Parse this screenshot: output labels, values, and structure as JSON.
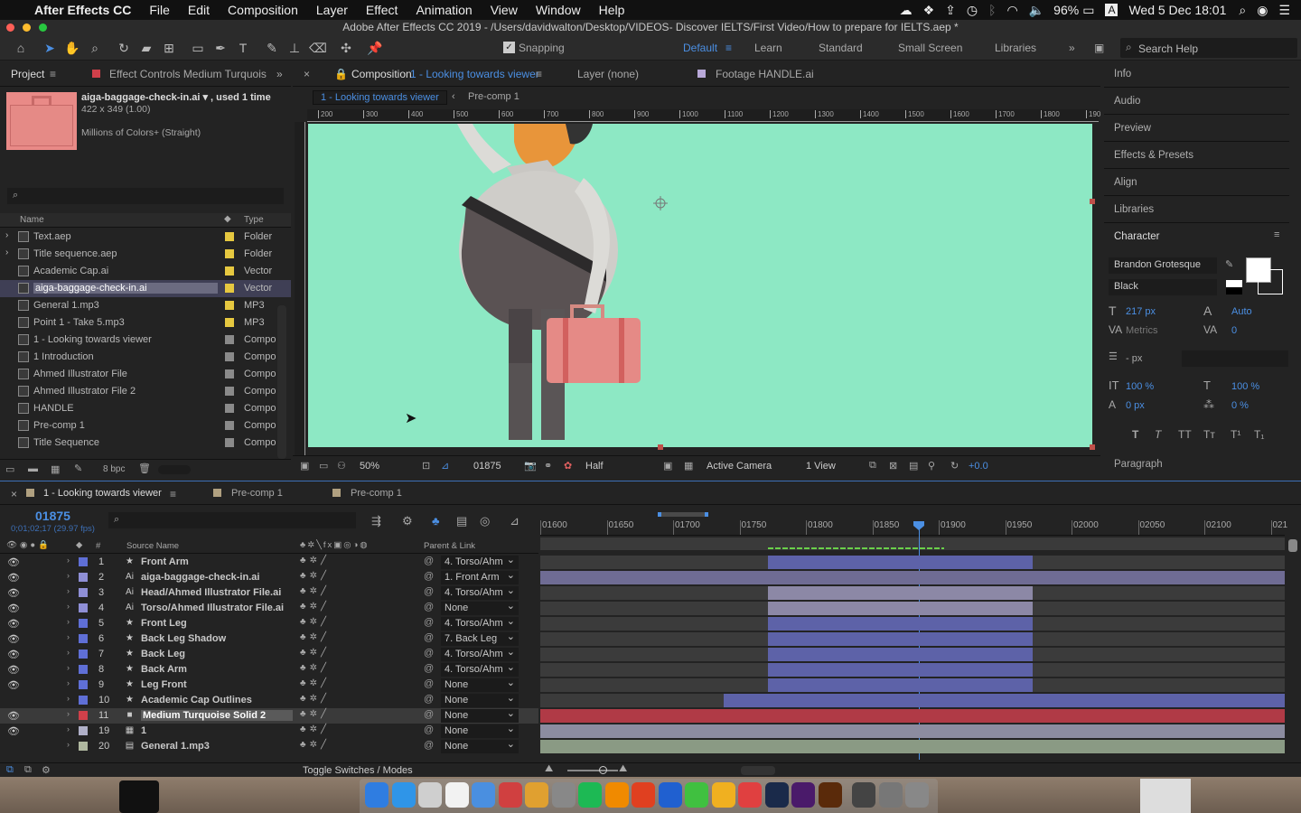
{
  "menubar": {
    "app": "After Effects CC",
    "items": [
      "File",
      "Edit",
      "Composition",
      "Layer",
      "Effect",
      "Animation",
      "View",
      "Window",
      "Help"
    ],
    "battery": "96%",
    "datetime": "Wed 5 Dec  18:01",
    "input": "A"
  },
  "titlebar": {
    "title": "Adobe After Effects CC 2019 - /Users/davidwalton/Desktop/VIDEOS- Discover IELTS/First Video/How to prepare for IELTS.aep *"
  },
  "toolbar": {
    "snapping": "Snapping",
    "workspaces": [
      "Default",
      "Learn",
      "Standard",
      "Small Screen",
      "Libraries"
    ],
    "search": "Search Help"
  },
  "project": {
    "tab": "Project",
    "tab2": "Effect Controls Medium Turquois",
    "file": "aiga-baggage-check-in.ai ▾ , used 1 time",
    "dims": "422 x 349 (1.00)",
    "colors": "Millions of Colors+ (Straight)",
    "col_name": "Name",
    "col_type": "Type",
    "bpc": "8 bpc",
    "items": [
      {
        "name": "Text.aep",
        "type": "Folder",
        "color": "#e6c840",
        "arrow": "›",
        "selected": false
      },
      {
        "name": "Title sequence.aep",
        "type": "Folder",
        "color": "#e6c840",
        "arrow": "›",
        "selected": false
      },
      {
        "name": "Academic Cap.ai",
        "type": "Vector",
        "color": "#e6c840",
        "arrow": "",
        "selected": false
      },
      {
        "name": "aiga-baggage-check-in.ai",
        "type": "Vector",
        "color": "#e6c840",
        "arrow": "",
        "selected": true
      },
      {
        "name": "General 1.mp3",
        "type": "MP3",
        "color": "#e6c840",
        "arrow": "",
        "selected": false
      },
      {
        "name": "Point 1 - Take 5.mp3",
        "type": "MP3",
        "color": "#e6c840",
        "arrow": "",
        "selected": false
      },
      {
        "name": "1 - Looking towards viewer",
        "type": "Compo",
        "color": "#8a8a8a",
        "arrow": "",
        "selected": false
      },
      {
        "name": "1 Introduction",
        "type": "Compo",
        "color": "#8a8a8a",
        "arrow": "",
        "selected": false
      },
      {
        "name": "Ahmed Illustrator File",
        "type": "Compo",
        "color": "#8a8a8a",
        "arrow": "",
        "selected": false
      },
      {
        "name": "Ahmed Illustrator File 2",
        "type": "Compo",
        "color": "#8a8a8a",
        "arrow": "",
        "selected": false
      },
      {
        "name": "HANDLE",
        "type": "Compo",
        "color": "#8a8a8a",
        "arrow": "",
        "selected": false
      },
      {
        "name": "Pre-comp 1",
        "type": "Compo",
        "color": "#8a8a8a",
        "arrow": "",
        "selected": false
      },
      {
        "name": "Title Sequence",
        "type": "Compo",
        "color": "#8a8a8a",
        "arrow": "",
        "selected": false
      }
    ]
  },
  "comp": {
    "tab": "Composition",
    "tab_name": "1 - Looking towards viewer",
    "layer_tab": "Layer (none)",
    "footage_tab": "Footage HANDLE.ai",
    "crumb1": "1 - Looking towards viewer",
    "crumb2": "Pre-comp 1",
    "ruler": [
      "200",
      "300",
      "400",
      "500",
      "600",
      "700",
      "800",
      "900",
      "1000",
      "1100",
      "1200",
      "1300",
      "1400",
      "1500",
      "1600",
      "1700",
      "1800",
      "190"
    ],
    "zoom": "50%",
    "timecode": "01875",
    "resolution": "Half",
    "camera": "Active Camera",
    "views": "1 View",
    "exposure": "+0.0",
    "bg": "#8de8c4"
  },
  "right": {
    "panels": [
      "Info",
      "Audio",
      "Preview",
      "Effects & Presets",
      "Align",
      "Libraries"
    ],
    "character": "Character",
    "font": "Brandon Grotesque",
    "style": "Black",
    "size": "217 px",
    "leading": "Auto",
    "kerning": "Metrics",
    "tracking": "0",
    "stroke": "- px",
    "vscale": "100 %",
    "hscale": "100 %",
    "baseline": "0 px",
    "tsume": "0 %",
    "paragraph": "Paragraph"
  },
  "timeline": {
    "tabs": [
      "1 - Looking towards viewer",
      "Pre-comp 1",
      "Pre-comp 1"
    ],
    "timecode": "01875",
    "sub": "0;01;02;17 (29.97 fps)",
    "col_source": "Source Name",
    "col_parent": "Parent & Link",
    "ruler": [
      "01600",
      "01650",
      "01700",
      "01750",
      "01800",
      "01850",
      "01900",
      "01950",
      "02000",
      "02050",
      "02100",
      "021"
    ],
    "toggle": "Toggle Switches / Modes",
    "layers": [
      {
        "num": "1",
        "name": "Front Arm",
        "icon": "★",
        "color": "#5f6fd6",
        "parent": "4. Torso/Ahm",
        "eye": true
      },
      {
        "num": "2",
        "name": "aiga-baggage-check-in.ai",
        "icon": "Ai",
        "color": "#8f8fd6",
        "parent": "1. Front Arm",
        "eye": true
      },
      {
        "num": "3",
        "name": "Head/Ahmed Illustrator File.ai",
        "icon": "Ai",
        "color": "#8f8fd6",
        "parent": "4. Torso/Ahm",
        "eye": true
      },
      {
        "num": "4",
        "name": "Torso/Ahmed Illustrator File.ai",
        "icon": "Ai",
        "color": "#8f8fd6",
        "parent": "None",
        "eye": true
      },
      {
        "num": "5",
        "name": "Front Leg",
        "icon": "★",
        "color": "#5f6fd6",
        "parent": "4. Torso/Ahm",
        "eye": true
      },
      {
        "num": "6",
        "name": "Back Leg Shadow",
        "icon": "★",
        "color": "#5f6fd6",
        "parent": "7. Back Leg",
        "eye": true
      },
      {
        "num": "7",
        "name": "Back Leg",
        "icon": "★",
        "color": "#5f6fd6",
        "parent": "4. Torso/Ahm",
        "eye": true
      },
      {
        "num": "8",
        "name": "Back Arm",
        "icon": "★",
        "color": "#5f6fd6",
        "parent": "4. Torso/Ahm",
        "eye": true
      },
      {
        "num": "9",
        "name": "Leg Front",
        "icon": "★",
        "color": "#5f6fd6",
        "parent": "None",
        "eye": true
      },
      {
        "num": "10",
        "name": "Academic Cap Outlines",
        "icon": "★",
        "color": "#5f6fd6",
        "parent": "None",
        "eye": false
      },
      {
        "num": "11",
        "name": "Medium Turquoise Solid 2",
        "icon": "■",
        "color": "#d0404a",
        "parent": "None",
        "eye": true
      },
      {
        "num": "19",
        "name": "1",
        "icon": "▦",
        "color": "#b0b0c8",
        "parent": "None",
        "eye": true
      },
      {
        "num": "20",
        "name": "General 1.mp3",
        "icon": "▤",
        "color": "#b0b8a0",
        "parent": "None",
        "eye": false
      }
    ]
  }
}
